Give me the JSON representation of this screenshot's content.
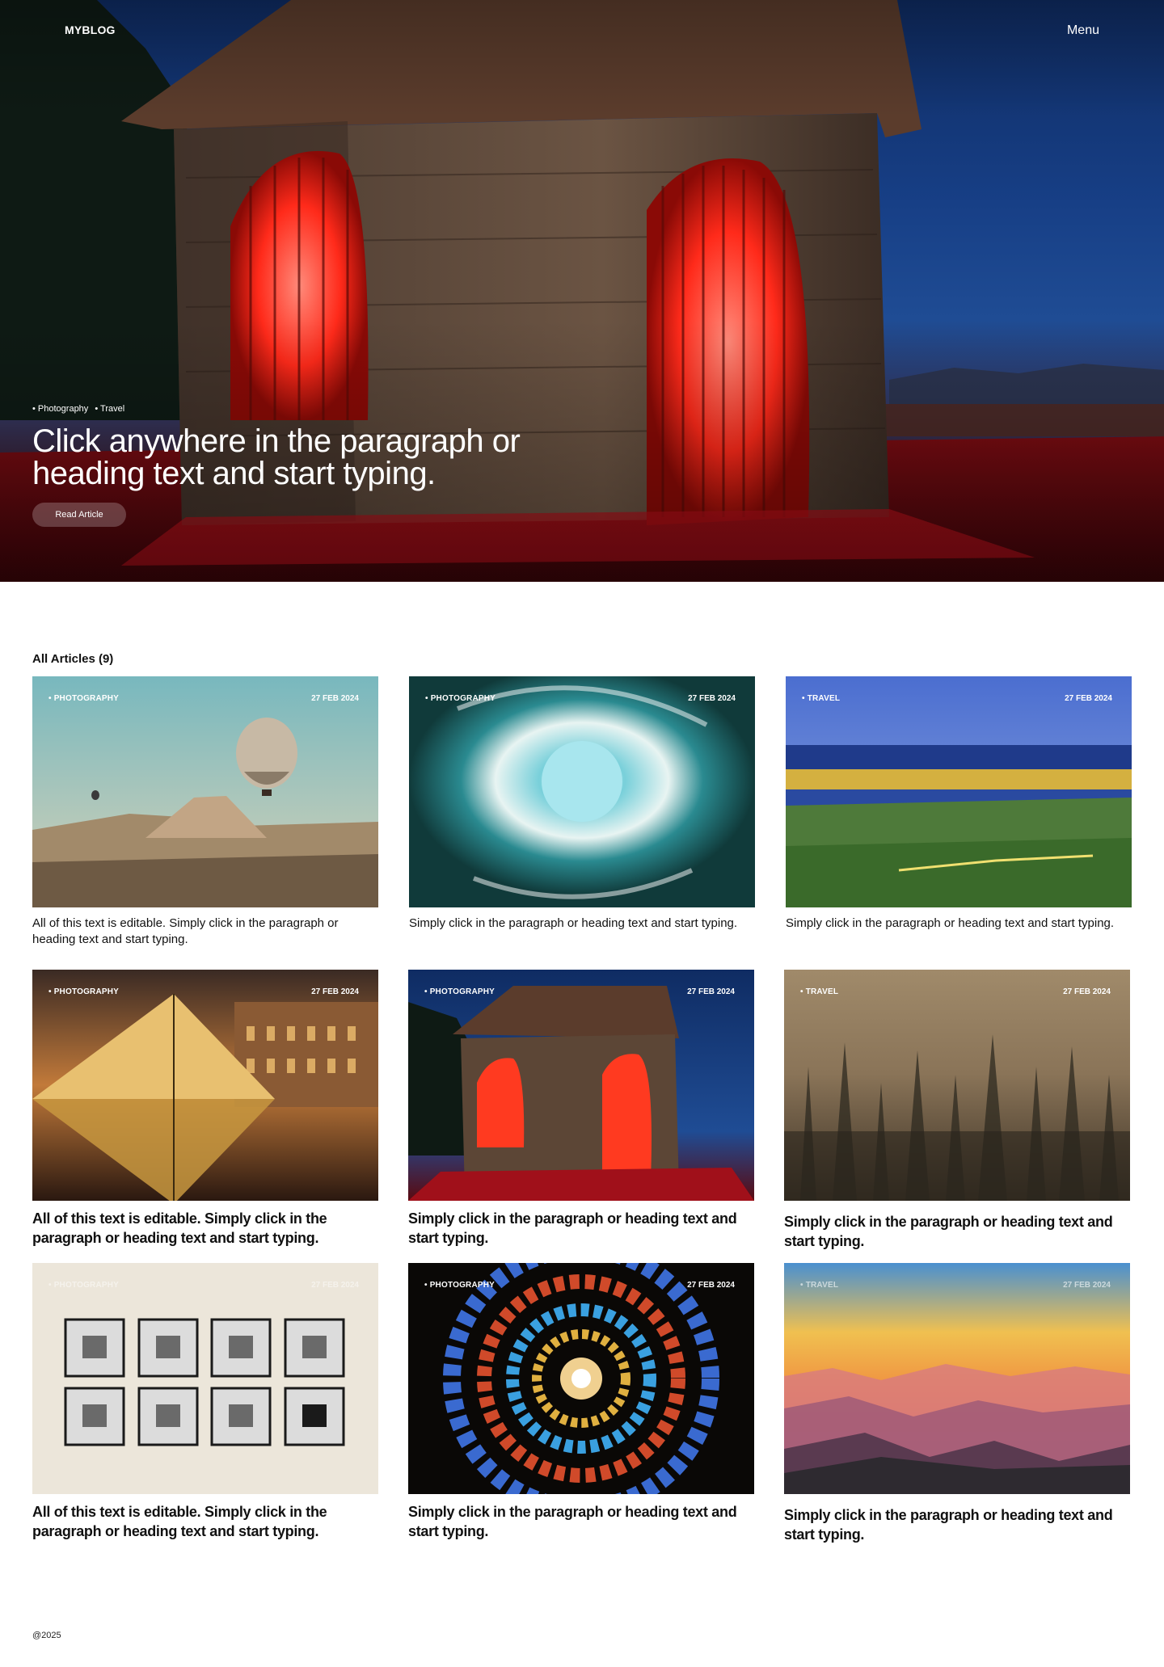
{
  "header": {
    "brand": "MYBLOG",
    "menu_label": "Menu"
  },
  "hero": {
    "tags": [
      "Photography",
      "Travel"
    ],
    "title": "Click anywhere in the paragraph or heading text and start typing.",
    "button_label": "Read Article"
  },
  "articles": {
    "heading": "All Articles (9)",
    "items": [
      {
        "category": "Photography",
        "date": "27 FEB 2024",
        "excerpt": "All of this text is editable. Simply click in the paragraph or heading text and start typing.",
        "image": "hot-air-balloon"
      },
      {
        "category": "Photography",
        "date": "27 FEB 2024",
        "excerpt": "Simply click in the paragraph or heading text and start typing.",
        "image": "ocean-wave-tunnel"
      },
      {
        "category": "Travel",
        "date": "27 FEB 2024",
        "excerpt": "Simply click in the paragraph or heading text and start typing.",
        "image": "stadium-field"
      },
      {
        "category": "Photography",
        "date": "27 FEB 2024",
        "excerpt": "All of this text is editable. Simply click in the paragraph or heading text and start typing.",
        "image": "louvre-pyramid"
      },
      {
        "category": "Photography",
        "date": "27 FEB 2024",
        "excerpt": "Simply click in the paragraph or heading text and start typing.",
        "image": "stone-hut-red-light"
      },
      {
        "category": "Travel",
        "date": "27 FEB 2024",
        "excerpt": "Simply click in the paragraph or heading text and start typing.",
        "image": "misty-forest"
      },
      {
        "category": "Photography",
        "date": "27 FEB 2024",
        "excerpt": "All of this text is editable. Simply click in the paragraph or heading text and start typing.",
        "image": "framed-gallery-wall"
      },
      {
        "category": "Photography",
        "date": "27 FEB 2024",
        "excerpt": "Simply click in the paragraph or heading text and start typing.",
        "image": "stained-glass-spiral"
      },
      {
        "category": "Travel",
        "date": "27 FEB 2024",
        "excerpt": "Simply click in the paragraph or heading text and start typing.",
        "image": "mountain-sunset"
      }
    ]
  },
  "footer": {
    "copyright": "@2025"
  }
}
